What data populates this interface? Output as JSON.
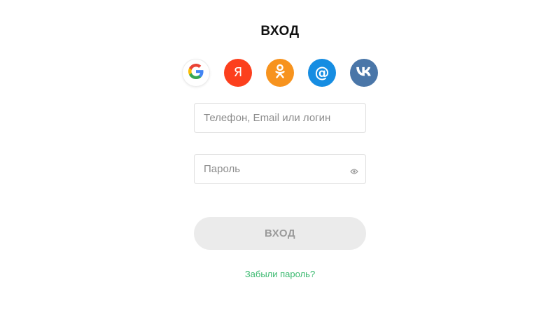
{
  "title": "ВХОД",
  "social": [
    {
      "name": "google-icon",
      "glyph": "G",
      "color": "#ffffff"
    },
    {
      "name": "yandex-icon",
      "glyph": "Я",
      "color": "#fc3f1d"
    },
    {
      "name": "odnoklassniki-icon",
      "glyph": "ok",
      "color": "#f7931e"
    },
    {
      "name": "mail-icon",
      "glyph": "@",
      "color": "#168de2"
    },
    {
      "name": "vk-icon",
      "glyph": "vk",
      "color": "#4a76a8"
    }
  ],
  "form": {
    "login_placeholder": "Телефон, Email или логин",
    "password_placeholder": "Пароль",
    "submit_label": "ВХОД",
    "forgot_label": "Забыли пароль?"
  },
  "colors": {
    "button_bg": "#ebebeb",
    "button_text": "#9a9a9a",
    "link": "#3ab96f",
    "eye": "#9a9a9a"
  }
}
